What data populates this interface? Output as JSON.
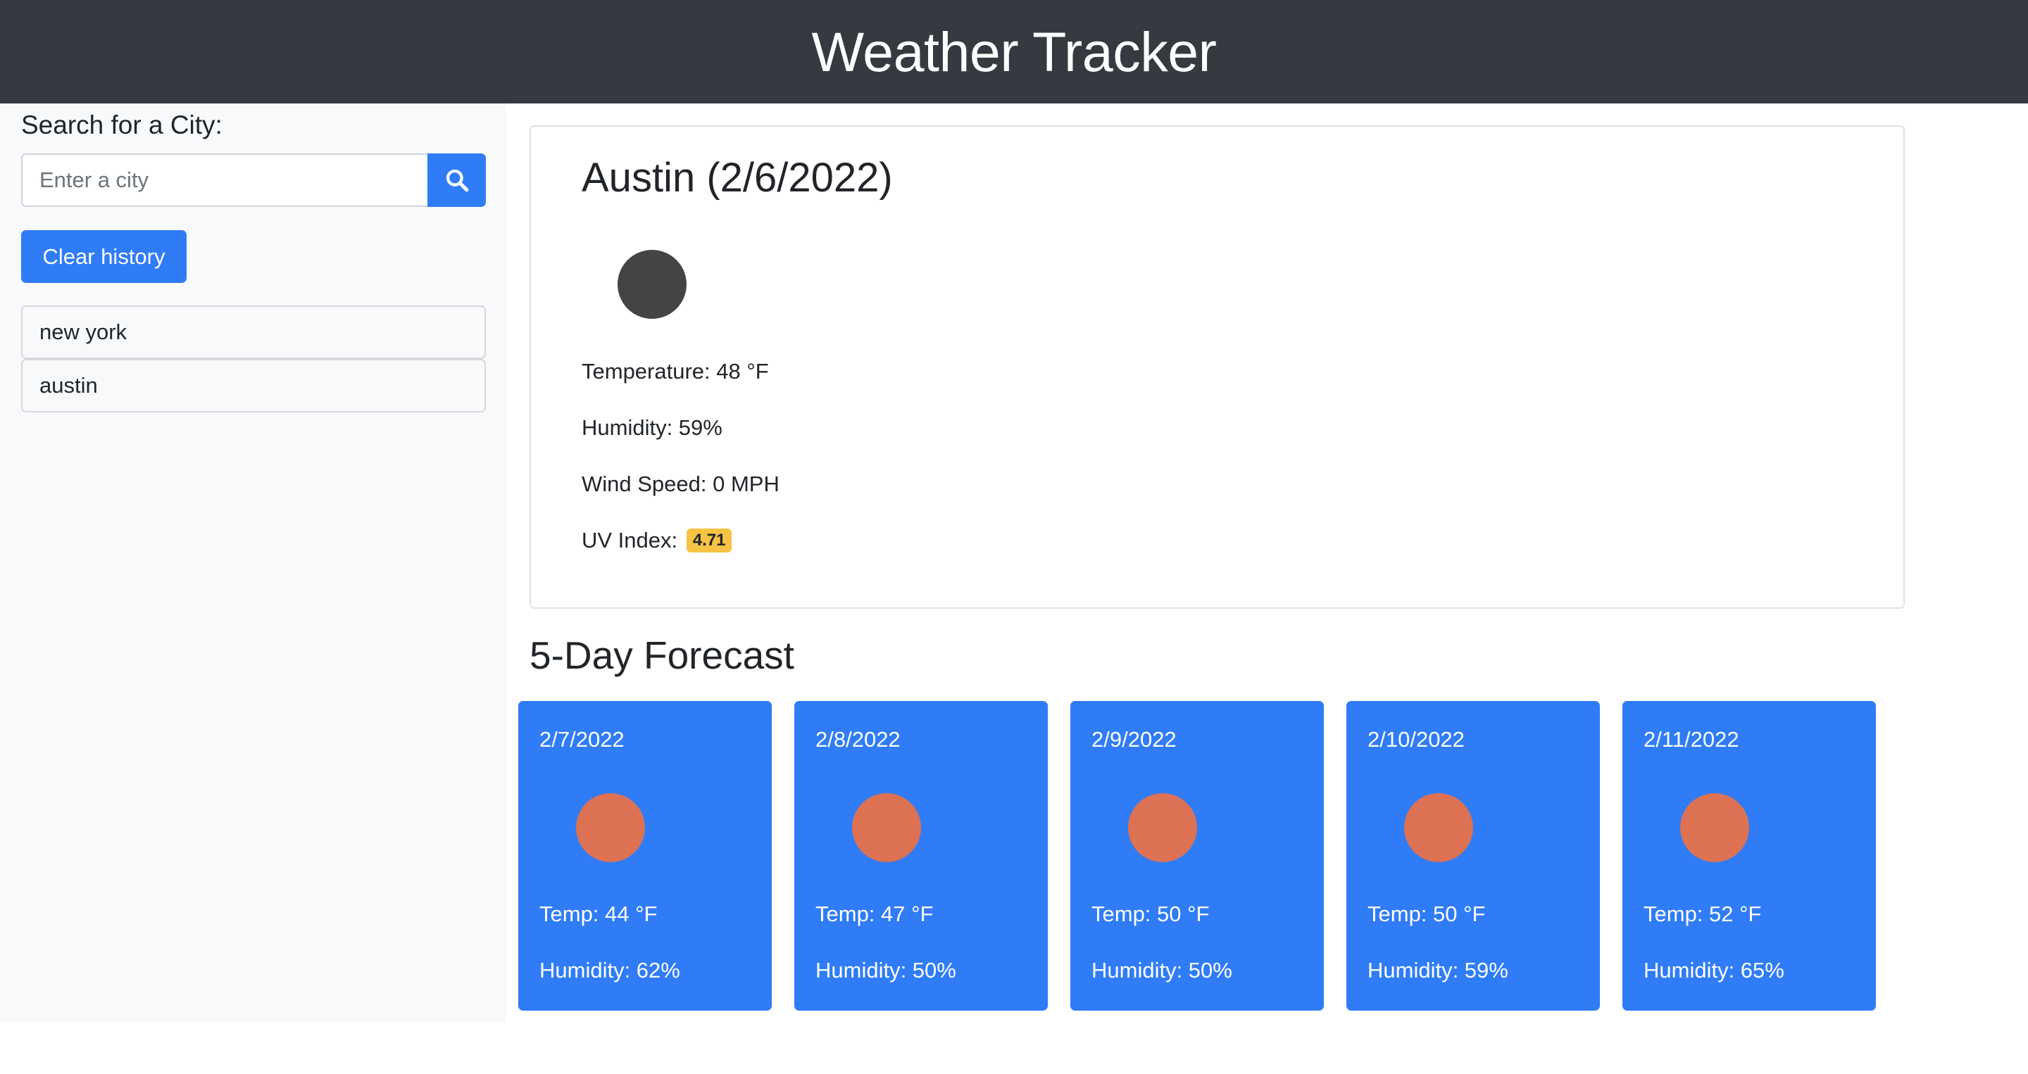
{
  "header": {
    "title": "Weather Tracker"
  },
  "search": {
    "label": "Search for a City:",
    "placeholder": "Enter a city",
    "value": "",
    "button_icon": "search-icon",
    "clear_label": "Clear history"
  },
  "history": [
    {
      "label": "new york"
    },
    {
      "label": "austin"
    }
  ],
  "current": {
    "title": "Austin (2/6/2022)",
    "icon": "weather-icon",
    "temperature": "Temperature: 48 °F",
    "humidity": "Humidity: 59%",
    "wind": "Wind Speed: 0 MPH",
    "uv_label": "UV Index:",
    "uv_value": "4.71"
  },
  "forecast": {
    "title": "5-Day Forecast",
    "days": [
      {
        "date": "2/7/2022",
        "temp": "Temp: 44 °F",
        "humidity": "Humidity: 62%",
        "icon": "weather-icon"
      },
      {
        "date": "2/8/2022",
        "temp": "Temp: 47 °F",
        "humidity": "Humidity: 50%",
        "icon": "weather-icon"
      },
      {
        "date": "2/9/2022",
        "temp": "Temp: 50 °F",
        "humidity": "Humidity: 50%",
        "icon": "weather-icon"
      },
      {
        "date": "2/10/2022",
        "temp": "Temp: 50 °F",
        "humidity": "Humidity: 59%",
        "icon": "weather-icon"
      },
      {
        "date": "2/11/2022",
        "temp": "Temp: 52 °F",
        "humidity": "Humidity: 65%",
        "icon": "weather-icon"
      }
    ]
  },
  "colors": {
    "header_bg": "#343a40",
    "primary": "#2f7cf6",
    "uv_badge": "#f6c344",
    "current_icon": "#444446",
    "forecast_icon": "#dd7153"
  }
}
